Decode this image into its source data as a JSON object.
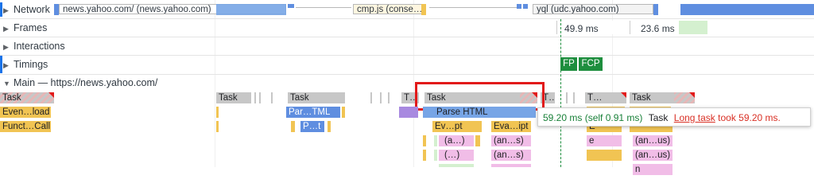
{
  "tracks": {
    "network": "Network",
    "frames": "Frames",
    "interactions": "Interactions",
    "timings": "Timings",
    "main": "Main — https://news.yahoo.com/"
  },
  "network_bars": {
    "news": "news.yahoo.com/ (news.yahoo.com)",
    "cmp": "cmp.js (conse…",
    "ygl": "yql (udc.yahoo.com)"
  },
  "frames": {
    "frame1": "49.9 ms",
    "frame2": "23.6 ms"
  },
  "timings": {
    "fp": "FP",
    "fcp": "FCP"
  },
  "main_row1": {
    "task_a": "Task",
    "task_b": "Task",
    "task_c": "Task",
    "task_d": "T…",
    "task_selected": "Task",
    "task_f": "T…",
    "task_g": "T…",
    "task_h": "Task"
  },
  "main_row2": {
    "evenload": "Even…load",
    "partml": "Par…TML",
    "parsehtml": "Parse HTML"
  },
  "main_row3": {
    "functcall": "Funct…Call",
    "pt": "P…t",
    "evpt": "Ev…pt",
    "evaipt": "Eva…ipt",
    "e": "E"
  },
  "main_row4": {
    "a1": "(a…)",
    "anus1": "(an…s)",
    "e": "e",
    "anus2": "(an…us)"
  },
  "main_row5": {
    "dots": "(…)",
    "anus3": "(an…s)",
    "anus4": "(an…us)"
  },
  "main_row6": {
    "n": "n"
  },
  "tooltip": {
    "duration": "59.20 ms (self 0.91 ms)",
    "name": "Task",
    "link": "Long task",
    "rest": " took 59.20 ms."
  },
  "colors": {
    "scripting": "#f1c453",
    "loading": "#77a5e6",
    "highlight": "#e21a1a",
    "tooltip_duration": "#188038",
    "timing_marker": "#1e8e3e"
  }
}
